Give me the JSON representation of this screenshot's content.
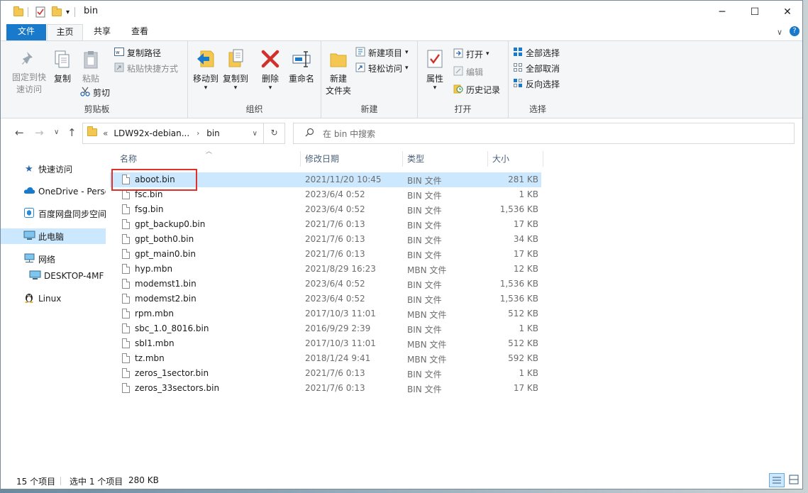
{
  "window": {
    "title": "bin",
    "buttons": {
      "minimize": "─",
      "maximize": "☐",
      "close": "✕"
    }
  },
  "tabs": [
    {
      "label": "文件"
    },
    {
      "label": "主页"
    },
    {
      "label": "共享"
    },
    {
      "label": "查看"
    }
  ],
  "ribbon": {
    "clipboard": {
      "group_label": "剪贴板",
      "pin_quick_access": "固定到快\n速访问",
      "copy": "复制",
      "paste": "粘贴",
      "copy_path": "复制路径",
      "paste_shortcut": "粘贴快捷方式",
      "cut": "剪切"
    },
    "organize": {
      "group_label": "组织",
      "move_to": "移动到",
      "copy_to": "复制到",
      "delete": "删除",
      "rename": "重命名"
    },
    "new": {
      "group_label": "新建",
      "new_folder": "新建\n文件夹",
      "new_item": "新建项目",
      "easy_access": "轻松访问"
    },
    "open": {
      "group_label": "打开",
      "properties": "属性",
      "open": "打开",
      "edit": "编辑",
      "history": "历史记录"
    },
    "select": {
      "group_label": "选择",
      "select_all": "全部选择",
      "select_none": "全部取消",
      "invert": "反向选择"
    }
  },
  "nav": {
    "breadcrumb_prefix": "«",
    "breadcrumb_parent": "LDW92x-debian...",
    "breadcrumb_current": "bin",
    "search_placeholder": "在 bin 中搜索"
  },
  "sidebar": {
    "items": [
      {
        "label": "快速访问",
        "icon": "star-icon"
      },
      {
        "label": "OneDrive - Perso",
        "icon": "cloud-icon"
      },
      {
        "label": "百度网盘同步空间",
        "icon": "baidu-icon"
      },
      {
        "label": "此电脑",
        "icon": "computer-icon"
      },
      {
        "label": "网络",
        "icon": "network-icon"
      },
      {
        "label": "DESKTOP-4MF",
        "icon": "computer-icon"
      },
      {
        "label": "Linux",
        "icon": "linux-icon"
      }
    ]
  },
  "columns": {
    "name": "名称",
    "date": "修改日期",
    "type": "类型",
    "size": "大小"
  },
  "files": [
    {
      "name": "aboot.bin",
      "date": "2021/11/20 10:45",
      "type": "BIN 文件",
      "size": "281 KB"
    },
    {
      "name": "fsc.bin",
      "date": "2023/6/4 0:52",
      "type": "BIN 文件",
      "size": "1 KB"
    },
    {
      "name": "fsg.bin",
      "date": "2023/6/4 0:52",
      "type": "BIN 文件",
      "size": "1,536 KB"
    },
    {
      "name": "gpt_backup0.bin",
      "date": "2021/7/6 0:13",
      "type": "BIN 文件",
      "size": "17 KB"
    },
    {
      "name": "gpt_both0.bin",
      "date": "2021/7/6 0:13",
      "type": "BIN 文件",
      "size": "34 KB"
    },
    {
      "name": "gpt_main0.bin",
      "date": "2021/7/6 0:13",
      "type": "BIN 文件",
      "size": "17 KB"
    },
    {
      "name": "hyp.mbn",
      "date": "2021/8/29 16:23",
      "type": "MBN 文件",
      "size": "12 KB"
    },
    {
      "name": "modemst1.bin",
      "date": "2023/6/4 0:52",
      "type": "BIN 文件",
      "size": "1,536 KB"
    },
    {
      "name": "modemst2.bin",
      "date": "2023/6/4 0:52",
      "type": "BIN 文件",
      "size": "1,536 KB"
    },
    {
      "name": "rpm.mbn",
      "date": "2017/10/3 11:01",
      "type": "MBN 文件",
      "size": "512 KB"
    },
    {
      "name": "sbc_1.0_8016.bin",
      "date": "2016/9/29 2:39",
      "type": "BIN 文件",
      "size": "1 KB"
    },
    {
      "name": "sbl1.mbn",
      "date": "2017/10/3 11:01",
      "type": "MBN 文件",
      "size": "512 KB"
    },
    {
      "name": "tz.mbn",
      "date": "2018/1/24 9:41",
      "type": "MBN 文件",
      "size": "592 KB"
    },
    {
      "name": "zeros_1sector.bin",
      "date": "2021/7/6 0:13",
      "type": "BIN 文件",
      "size": "1 KB"
    },
    {
      "name": "zeros_33sectors.bin",
      "date": "2021/7/6 0:13",
      "type": "BIN 文件",
      "size": "17 KB"
    }
  ],
  "selected_file": "aboot.bin",
  "status": {
    "item_count": "15 个项目",
    "selection": "选中 1 个项目",
    "selection_size": "280 KB"
  },
  "colors": {
    "accent": "#1979ca",
    "selection": "#cce8ff",
    "highlight_box": "#e0302a"
  }
}
